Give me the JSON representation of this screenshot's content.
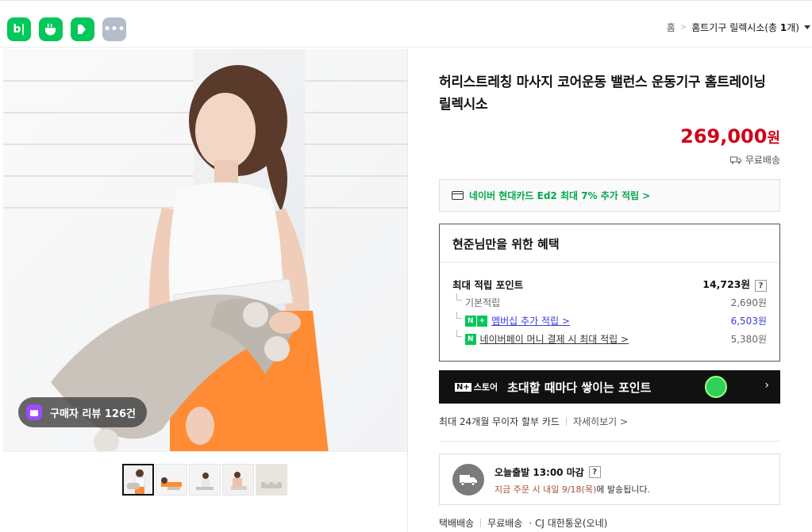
{
  "header": {
    "app_icons": [
      {
        "label": "b|",
        "name": "blog"
      },
      {
        "label": "☕",
        "name": "cafe"
      },
      {
        "label": "K",
        "name": "kin"
      },
      {
        "label": "•••",
        "name": "more"
      }
    ],
    "breadcrumb": {
      "home": "홈",
      "separator": ">",
      "current": "홈트기구 릴렉시소",
      "count_prefix": "(총 ",
      "count_value": "1",
      "count_suffix": "개)",
      "dropdown_icon": "caret-down-icon"
    }
  },
  "gallery": {
    "review_badge": "구매자 리뷰 126건",
    "thumbnails_count": 5
  },
  "product": {
    "title": "허리스트레칭 마사지 코어운동 밸런스 운동기구 홈트레이닝 릴렉시소",
    "price": "269,000",
    "price_unit": "원",
    "shipping": "무료배송",
    "card_promo": "네이버 현대카드 Ed2 최대 7% 추가 적립 >",
    "accent_color": "#d0021b",
    "naver_green": "#03c75a"
  },
  "benefit": {
    "title": "현준님만을 위한 혜택",
    "max_label": "최대 적립 포인트",
    "max_value": "14,723원",
    "help": "?",
    "rows": [
      {
        "label": "기본적립",
        "value": "2,690원"
      },
      {
        "badge_n": "N",
        "badge_plus": "+",
        "label": "멤버십 추가 적립 >",
        "value": "6,503원"
      },
      {
        "badge_n": "N",
        "label": "네이버페이 머니 결제 시 최대 적립 >",
        "value": "5,380원"
      }
    ]
  },
  "store_banner": {
    "logo_box": "N+",
    "logo_text": "스토어",
    "text": "초대할 때마다 쌓이는 포인트",
    "chevron": "›"
  },
  "installment": {
    "text": "최대 24개월 무이자 할부 카드",
    "more": "자세히보기 >"
  },
  "dispatch": {
    "line1": "오늘출발 13:00 마감",
    "help": "?",
    "line2_red": "지금 주문 시 내일 9/18(목)",
    "line2_rest": "에 발송됩니다."
  },
  "delivery": {
    "type": "택배배송",
    "fee": "무료배송",
    "carrier": "· CJ 대한통운(오네)"
  }
}
